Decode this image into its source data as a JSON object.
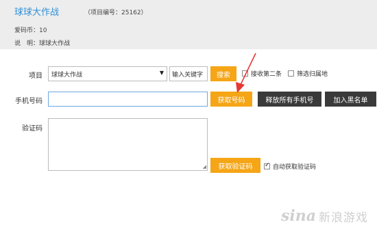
{
  "header": {
    "title": "球球大作战",
    "project_id": "（项目编号：25162）",
    "coins": "爱码币：10",
    "description": "说　明：球球大作战"
  },
  "form": {
    "project_label": "项目",
    "project_select_value": "球球大作战",
    "keyword_placeholder": "输入关键字",
    "search_button": "搜索",
    "receive_second_label": "接收第二条",
    "filter_location_label": "筛选归属地",
    "phone_label": "手机号码",
    "get_number_button": "获取号码",
    "release_all_button": "释放所有手机号",
    "blacklist_button": "加入黑名单",
    "code_label": "验证码",
    "get_code_button": "获取验证码",
    "auto_get_code_label": "自动获取验证码"
  },
  "checkboxes": {
    "receive_second_checked": false,
    "filter_location_checked": false,
    "auto_get_code_checked": true
  },
  "watermark": {
    "logo": "sina",
    "text": "新浪游戏"
  },
  "colors": {
    "accent_orange": "#f5a516",
    "dark_button": "#3a3a3a",
    "title_blue": "#2f8fd8",
    "annotation_arrow": "#e53935"
  }
}
